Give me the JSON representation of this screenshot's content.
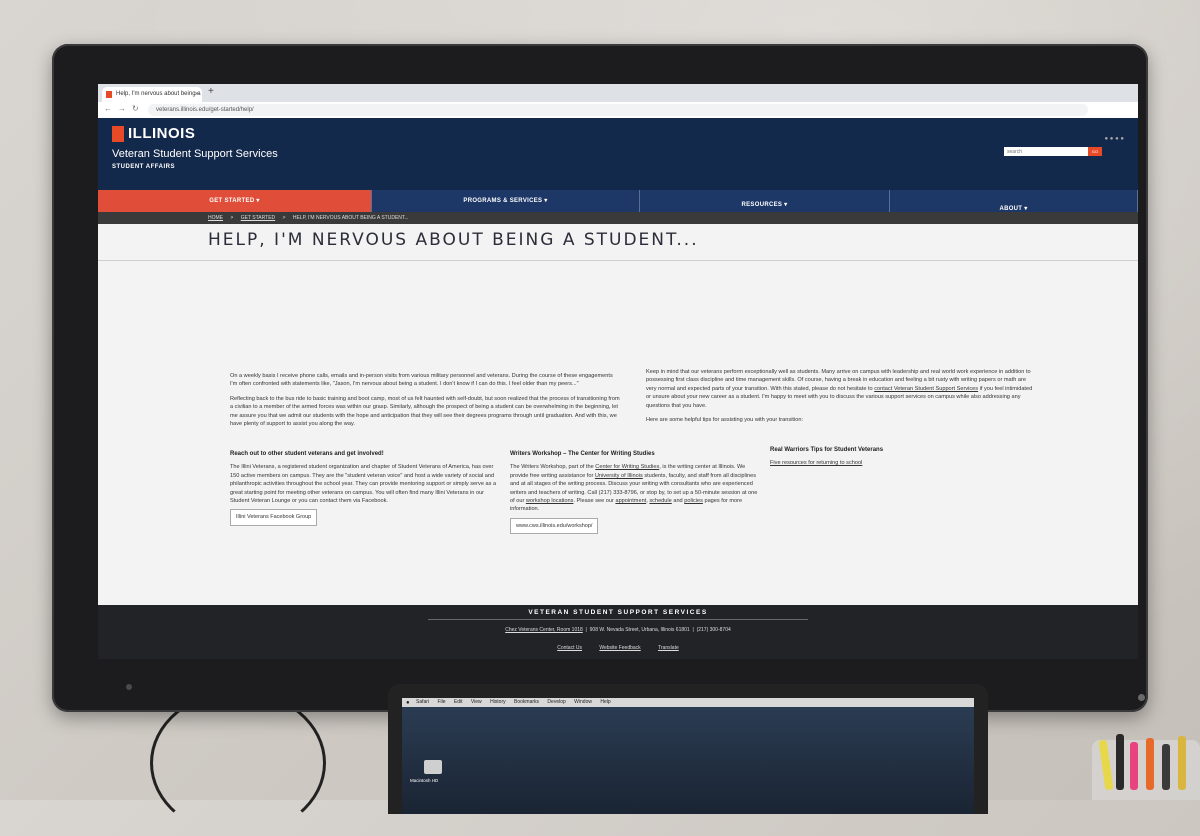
{
  "browser": {
    "tab_title": "Help, I'm nervous about being a",
    "tab_close": "×",
    "new_tab": "+",
    "url": "veterans.illinois.edu/get-started/help/"
  },
  "site": {
    "brand": "ILLINOIS",
    "unit": "Veteran Student Support Services",
    "subunit": "STUDENT AFFAIRS",
    "search_placeholder": "search",
    "search_button": "GO"
  },
  "nav": {
    "items": [
      {
        "label": "GET STARTED ▾"
      },
      {
        "label": "PROGRAMS & SERVICES ▾"
      },
      {
        "label": "RESOURCES ▾"
      },
      {
        "label": "ABOUT ▾"
      }
    ]
  },
  "breadcrumb": {
    "home": "HOME",
    "sep": ">",
    "get_started": "GET STARTED",
    "current": "HELP, I'M NERVOUS ABOUT BEING A STUDENT..."
  },
  "page": {
    "title": "HELP, I'M NERVOUS ABOUT BEING A STUDENT...",
    "left_p1": "On a weekly basis I receive phone calls, emails and in-person visits from various military personnel and veterans. During the course of these engagements I'm often confronted with statements like, \"Jason, I'm nervous about being a student. I don't know if I can do this. I feel older than my peers...\"",
    "left_p2": "Reflecting back to the bus ride to basic training and boot camp, most of us felt haunted with self-doubt, but soon realized that the process of transitioning from a civilian to a member of the armed forces was within our grasp. Similarly, although the prospect of being a student can be overwhelming in the beginning, let me assure you that we admit our students with the hope and anticipation that they will see their degrees programs through until graduation. And with this, we have plenty of support to assist you along the way.",
    "right_p1_a": "Keep in mind that our veterans perform exceptionally well as students. Many arrive on campus with leadership and real world work experience in addition to possessing first class discipline and time management skills. Of course, having a break in education and feeling a bit rusty with writing papers or math are very normal and expected parts of your transition. With this stated, please do not hesitate to",
    "right_p1_link": "contact Veteran Student Support Services",
    "right_p1_b": "if you feel intimidated or unsure about your new career as a student. I'm happy to meet with you to discuss the various support services on campus while also addressing any questions that you have.",
    "right_p2": "Here are some helpful tips for assisting you with your transition:",
    "s1_head": "Reach out to other student veterans and get involved!",
    "s1_body": "The Illini Veterans, a registered student organization and chapter of Student Veterans of America, has over 150 active members on campus. They are the \"student veteran voice\" and host a wide variety of social and philanthropic activities throughout the school year. They can provide mentoring support or simply serve as a great starting point for meeting other veterans on campus. You will often find many Illini Veterans in our Student Veteran Lounge or you can contact them via Facebook.",
    "s1_button": "Illini Veterans Facebook Group",
    "s2_head": "Writers Workshop – The Center for Writing Studies",
    "s2_body_a": "The Writers Workshop, part of the",
    "s2_link1": "Center for Writing Studies",
    "s2_body_b": ", is the writing center at Illinois. We provide free writing assistance for",
    "s2_link2": "University of Illinois",
    "s2_body_c": "students, faculty, and staff from all disciplines and at all stages of the writing process. Discuss your writing with consultants who are experienced writers and teachers of writing. Call (217) 333-8796, or stop by, to set up a 50-minute session at one of our",
    "s2_link3": "workshop locations",
    "s2_body_d": ". Please see our",
    "s2_link4": "appointment",
    "s2_link5": "schedule",
    "s2_and": "and",
    "s2_link6": "policies",
    "s2_body_e": "pages for more information.",
    "s2_button": "www.cws.illinois.edu/workshop/",
    "s3_head": "Real Warriors Tips for Student Veterans",
    "s3_link": "Five resources for returning to school"
  },
  "footer": {
    "title": "VETERAN STUDENT SUPPORT SERVICES",
    "address_link": "Chez Veterans Center, Room 1018",
    "address": "908 W. Nevada Street, Urbana, Illinois 61801",
    "phone": "(217) 300-8704",
    "links": [
      "Contact Us",
      "Website Feedback",
      "Translate"
    ]
  },
  "laptop": {
    "menu": [
      "Safari",
      "File",
      "Edit",
      "View",
      "History",
      "Bookmarks",
      "Develop",
      "Window",
      "Help"
    ],
    "drive_label": "Macintosh HD"
  }
}
